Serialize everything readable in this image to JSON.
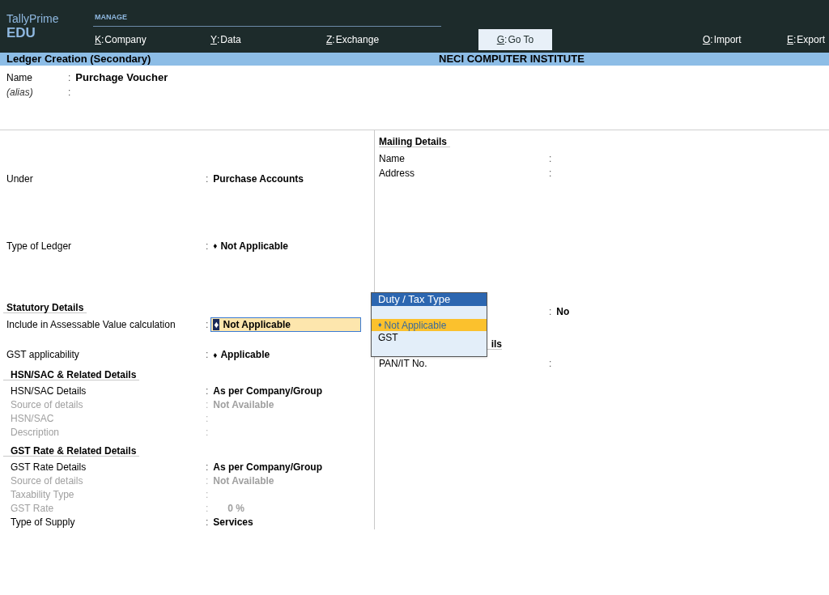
{
  "header": {
    "product": "TallyPrime",
    "edition": "EDU",
    "menu_group": "MANAGE",
    "menu": [
      {
        "key": "K",
        "sep": ":",
        "label": "Company",
        "selected": false
      },
      {
        "key": "Y",
        "sep": ":",
        "label": "Data",
        "selected": false
      },
      {
        "key": "Z",
        "sep": ":",
        "label": "Exchange",
        "selected": false
      },
      {
        "key": "G",
        "sep": ":",
        "label": "Go To",
        "selected": true
      },
      {
        "key": "O",
        "sep": ":",
        "label": "Import",
        "selected": false
      },
      {
        "key": "E",
        "sep": ":",
        "label": "Export",
        "selected": false
      }
    ]
  },
  "title_bar": {
    "screen": "Ledger Creation (Secondary)",
    "company": "NECI COMPUTER INSTITUTE"
  },
  "identity": [
    {
      "label": "Name",
      "colon": ":",
      "value": "Purchage Voucher",
      "italic": false
    },
    {
      "label": "(alias)",
      "colon": ":",
      "italic": true
    }
  ],
  "main_fields": [
    {
      "label": "Under",
      "colon": ":",
      "value": "Purchase Accounts",
      "selected": false
    },
    {
      "label": "Type of Ledger",
      "colon": ":",
      "bullet": "♦",
      "value": "Not Applicable",
      "selected": false
    }
  ],
  "statutory": {
    "title": "Statutory Details",
    "fields": [
      {
        "label": "Include in Assessable Value calculation",
        "colon": ":",
        "bullet": "♦",
        "value": "Not Applicable",
        "selected": true
      },
      {
        "label": "GST applicability",
        "colon": ":",
        "bullet": "♦",
        "value": "Applicable",
        "selected": false
      }
    ],
    "subsections": [
      {
        "title": "HSN/SAC & Related Details",
        "fields": [
          {
            "label": "HSN/SAC Details",
            "colon": ":",
            "value": "As per Company/Group",
            "disabled": false
          },
          {
            "label": "Source of details",
            "colon": ":",
            "value": "Not Available",
            "disabled": true
          },
          {
            "label": "HSN/SAC",
            "colon": ":",
            "disabled": true
          },
          {
            "label": "Description",
            "colon": ":",
            "disabled": true
          }
        ]
      },
      {
        "title": "GST Rate & Related Details",
        "fields": [
          {
            "label": "GST Rate Details",
            "colon": ":",
            "value": "As per Company/Group",
            "disabled": false
          },
          {
            "label": "Source of details",
            "colon": ":",
            "value": "Not Available",
            "disabled": true
          },
          {
            "label": "Taxability Type",
            "colon": ":",
            "disabled": true
          },
          {
            "label": "GST Rate",
            "colon": ":",
            "value": "0 %",
            "disabled": true
          },
          {
            "label": "Type of Supply",
            "colon": ":",
            "value": "Services",
            "disabled": false
          }
        ]
      }
    ]
  },
  "mailing": {
    "title": "Mailing Details",
    "fields": [
      {
        "label": "Name",
        "colon": ":"
      },
      {
        "label": "Address",
        "colon": ":"
      }
    ]
  },
  "banking": {
    "colon": ":",
    "value": "No"
  },
  "tax_registration": {
    "title": "ils",
    "fields": [
      {
        "label": "PAN/IT No.",
        "colon": ":"
      }
    ]
  },
  "popup": {
    "title": "Duty / Tax Type",
    "options": [
      {
        "bullet": "♦",
        "label": "Not Applicable",
        "selected": true
      },
      {
        "label": "GST",
        "selected": false
      }
    ]
  }
}
